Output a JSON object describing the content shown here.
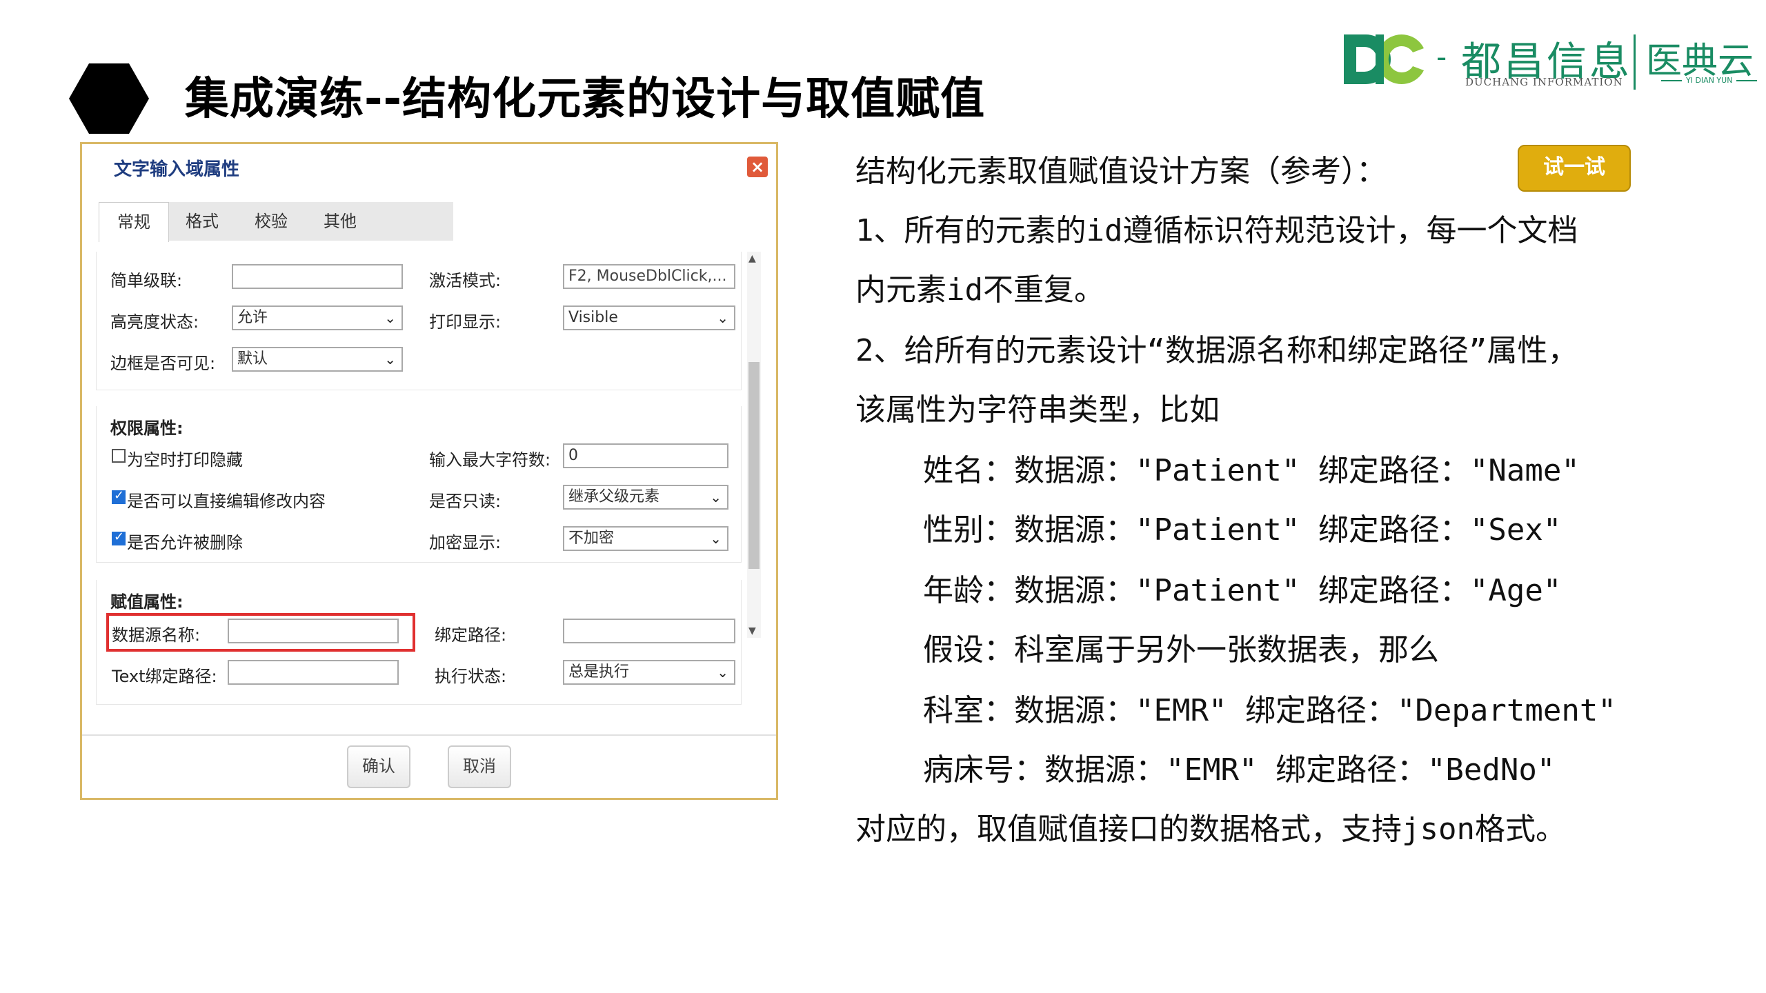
{
  "slide": {
    "title": "集成演练--结构化元素的设计与取值赋值"
  },
  "logo": {
    "dash": "-",
    "company_cn": "都昌信息",
    "company_en": "DUCHANG INFORMATION",
    "product_cn": "医典云",
    "product_en": "YI DIAN YUN",
    "colors": {
      "green": "#1a8c63",
      "lime": "#8dc63f"
    }
  },
  "dialog": {
    "title": "文字输入域属性",
    "close_icon": "close-icon",
    "tabs": [
      "常规",
      "格式",
      "校验",
      "其他"
    ],
    "active_tab": "常规",
    "general": {
      "simple_cascade_label": "简单级联:",
      "simple_cascade_value": "",
      "activate_mode_label": "激活模式:",
      "activate_mode_value": "F2, MouseDblClick,...",
      "highlight_state_label": "高亮度状态:",
      "highlight_state_value": "允许",
      "print_display_label": "打印显示:",
      "print_display_value": "Visible",
      "border_visible_label": "边框是否可见:",
      "border_visible_value": "默认"
    },
    "permission": {
      "title": "权限属性:",
      "hide_when_empty_label": "为空时打印隐藏",
      "hide_when_empty_checked": false,
      "editable_label": "是否可以直接编辑修改内容",
      "editable_checked": true,
      "deletable_label": "是否允许被删除",
      "deletable_checked": true,
      "max_chars_label": "输入最大字符数:",
      "max_chars_value": "0",
      "readonly_label": "是否只读:",
      "readonly_value": "继承父级元素",
      "encrypt_label": "加密显示:",
      "encrypt_value": "不加密"
    },
    "assignment": {
      "title": "赋值属性:",
      "datasource_label": "数据源名称:",
      "datasource_value": "",
      "bind_path_label": "绑定路径:",
      "bind_path_value": "",
      "text_bind_path_label": "Text绑定路径:",
      "text_bind_path_value": "",
      "exec_state_label": "执行状态:",
      "exec_state_value": "总是执行"
    },
    "ok_label": "确认",
    "cancel_label": "取消"
  },
  "content": {
    "heading": "结构化元素取值赋值设计方案（参考）：",
    "try_button": "试一试",
    "try_button_color": "#e0ad0e",
    "line1a": "1、所有的元素的id遵循标识符规范设计，每一个文档",
    "line1b": "内元素id不重复。",
    "line2a": "2、给所有的元素设计“数据源名称和绑定路径”属性，",
    "line2b": "该属性为字符串类型，比如",
    "ex_name": "姓名：数据源：\"Patient\" 绑定路径：\"Name\"",
    "ex_sex": "性别：数据源：\"Patient\" 绑定路径：\"Sex\"",
    "ex_age": "年龄：数据源：\"Patient\" 绑定路径：\"Age\"",
    "assume": "假设：科室属于另外一张数据表，那么",
    "ex_dept": "科室：数据源：\"EMR\" 绑定路径：\"Department\"",
    "ex_bed": "病床号：数据源：\"EMR\" 绑定路径：\"BedNo\"",
    "closing": "对应的，取值赋值接口的数据格式，支持json格式。"
  }
}
